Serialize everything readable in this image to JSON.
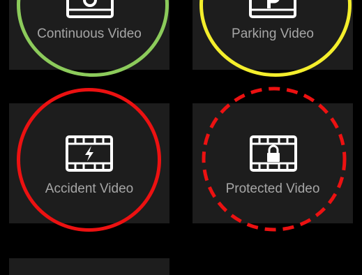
{
  "tiles": [
    {
      "id": "continuous",
      "label": "Continuous Video",
      "ring_color": "#8ccb5b",
      "ring_style": "solid",
      "icon": "film-record-icon"
    },
    {
      "id": "parking",
      "label": "Parking Video",
      "ring_color": "#f4ee2c",
      "ring_style": "solid",
      "icon": "film-parking-icon"
    },
    {
      "id": "accident",
      "label": "Accident Video",
      "ring_color": "#ec1111",
      "ring_style": "solid",
      "icon": "film-lightning-icon"
    },
    {
      "id": "protected",
      "label": "Protected Video",
      "ring_color": "#ec1111",
      "ring_style": "dashed",
      "icon": "film-lock-icon"
    }
  ],
  "colors": {
    "background": "#000000",
    "tile": "#1d1d1d",
    "label": "#a6a6a6",
    "icon": "#ffffff"
  }
}
